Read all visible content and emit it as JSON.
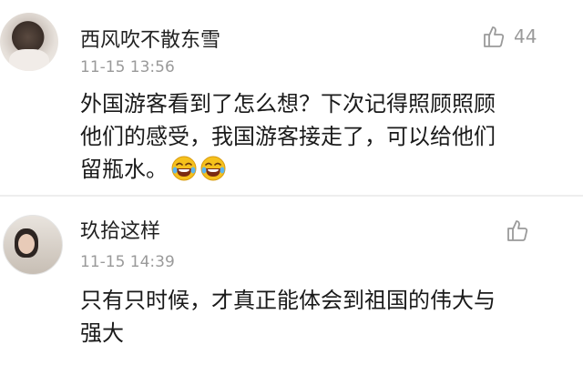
{
  "comments": [
    {
      "username": "西风吹不散东雪",
      "timestamp": "11-15 13:56",
      "like_count": "44",
      "text_lines": [
        "外国游客看到了怎么想？下次记得照顾照顾",
        "他们的感受，我国游客接走了，可以给他们",
        "留瓶水。"
      ],
      "emojis": [
        "laughing-tears-emoji",
        "laughing-tears-emoji"
      ]
    },
    {
      "username": "玖拾这样",
      "timestamp": "11-15 14:39",
      "like_count": "",
      "text_lines": [
        "只有只时候，才真正能体会到祖国的伟大与",
        "强大"
      ]
    }
  ],
  "icons": {
    "like": "thumbs-up-outline-icon",
    "emoji": "laughing-tears-emoji"
  },
  "colors": {
    "meta_gray": "#9a9a9a",
    "text": "#1a1a1a",
    "emoji_yellow": "#f6c11c"
  }
}
